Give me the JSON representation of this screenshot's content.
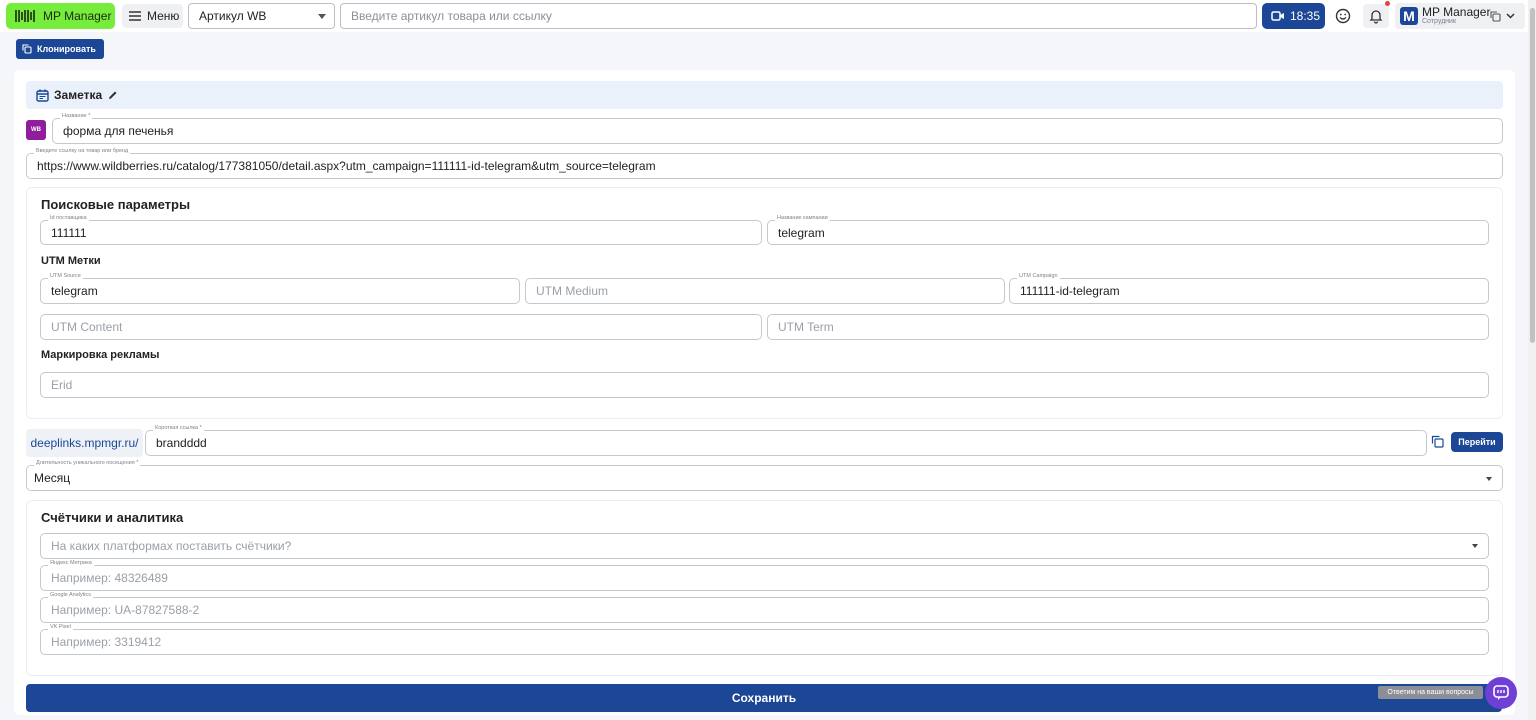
{
  "header": {
    "logo_label": "MP Manager",
    "menu_label": "Меню",
    "article_select": "Артикул WB",
    "search_placeholder": "Введите артикул товара или ссылку",
    "time": "18:35",
    "user_name": "MP Manager",
    "user_role": "Сотрудник",
    "user_initial": "M"
  },
  "toolbar": {
    "clone_label": "Клонировать"
  },
  "note": {
    "title": "Заметка",
    "wb_badge": "WB",
    "name_label": "Название *",
    "name_value": "форма для печенья",
    "link_label": "Введите ссылку на товар или бренд",
    "link_value": "https://www.wildberries.ru/catalog/177381050/detail.aspx?utm_campaign=111111-id-telegram&utm_source=telegram"
  },
  "search_params": {
    "title": "Поисковые параметры",
    "supplier_label": "Id поставщика",
    "supplier_value": "111111",
    "campaign_label": "Название кампании",
    "campaign_value": "telegram",
    "utm_title": "UTM Метки",
    "utm_source_label": "UTM Source",
    "utm_source_value": "telegram",
    "utm_medium_placeholder": "UTM Medium",
    "utm_campaign_label": "UTM Campaign",
    "utm_campaign_value": "111111-id-telegram",
    "utm_content_placeholder": "UTM Content",
    "utm_term_placeholder": "UTM Term",
    "ad_marking_title": "Маркировка рекламы",
    "erid_placeholder": "Erid"
  },
  "deeplink": {
    "prefix": "deeplinks.mpmgr.ru/",
    "short_label": "Короткая ссылка *",
    "short_value": "brandddd",
    "go_label": "Перейти"
  },
  "duration": {
    "label": "Длительность уникального посещения *",
    "value": "Месяц"
  },
  "analytics": {
    "title": "Счётчики и аналитика",
    "platforms_placeholder": "На каких платформах поставить счётчики?",
    "yandex_label": "Яндекс Метрика",
    "yandex_placeholder": "Например: 48326489",
    "google_label": "Google Analytics",
    "google_placeholder": "Например: UA-87827588-2",
    "vk_label": "VK Pixel",
    "vk_placeholder": "Например: 3319412"
  },
  "footer": {
    "save_label": "Сохранить",
    "help_tip": "Ответим на ваши вопросы"
  },
  "colors": {
    "brand_green": "#76ec3c",
    "primary_blue": "#1c4796",
    "wb_purple": "#8f1d9c",
    "chat_purple": "#6f3fd6"
  },
  "icons": [
    "logo-icon",
    "menu-icon",
    "chevron-down-icon",
    "video-icon",
    "smile-icon",
    "bell-icon",
    "copy-icon",
    "calendar-icon",
    "pencil-icon",
    "chat-icon"
  ]
}
